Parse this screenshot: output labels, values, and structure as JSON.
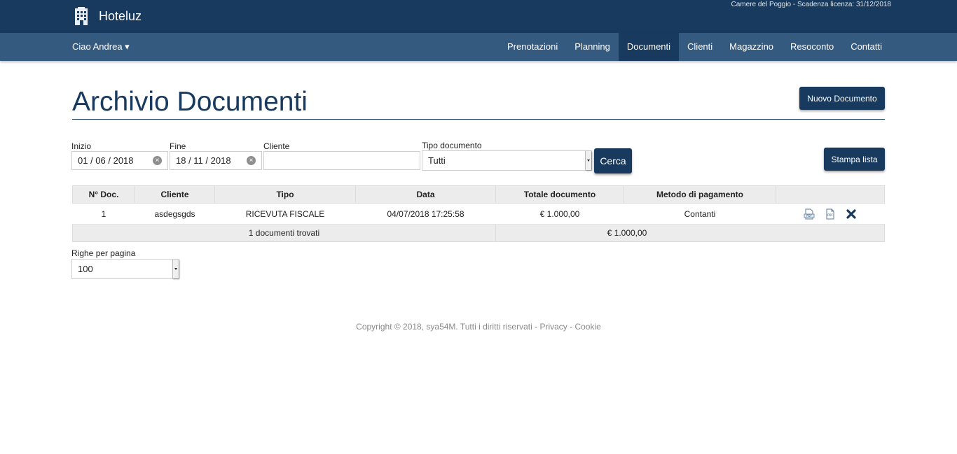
{
  "app": {
    "name": "Hoteluz",
    "license_text": "Camere del Poggio - Scadenza licenza: 31/12/2018"
  },
  "nav": {
    "user_menu": "Ciao Andrea ▾",
    "items": [
      {
        "label": "Prenotazioni"
      },
      {
        "label": "Planning"
      },
      {
        "label": "Documenti",
        "active": true
      },
      {
        "label": "Clienti"
      },
      {
        "label": "Magazzino"
      },
      {
        "label": "Resoconto"
      },
      {
        "label": "Contatti"
      }
    ]
  },
  "page": {
    "title": "Archivio Documenti",
    "new_button": "Nuovo Documento",
    "print_button": "Stampa lista"
  },
  "filters": {
    "start": {
      "label": "Inizio",
      "value": "01 / 06 / 2018"
    },
    "end": {
      "label": "Fine",
      "value": "18 / 11 / 2018"
    },
    "client": {
      "label": "Cliente",
      "value": ""
    },
    "doc_type": {
      "label": "Tipo documento",
      "value": "Tutti"
    },
    "search_button": "Cerca"
  },
  "table": {
    "headers": [
      "N° Doc.",
      "Cliente",
      "Tipo",
      "Data",
      "Totale documento",
      "Metodo di pagamento",
      ""
    ],
    "rows": [
      {
        "num": "1",
        "client": "asdegsgds",
        "type": "RICEVUTA FISCALE",
        "date": "04/07/2018 17:25:58",
        "total": "€ 1.000,00",
        "payment": "Contanti"
      }
    ],
    "footer": {
      "count_text": "1 documenti trovati",
      "total": "€ 1.000,00"
    }
  },
  "pagination": {
    "label": "Righe per pagina",
    "value": "100"
  },
  "footer": {
    "copyright": "Copyright © 2018, sya54M. Tutti i diritti riservati",
    "sep": " - ",
    "privacy": "Privacy",
    "cookie": "Cookie"
  },
  "colors": {
    "primary": "#173a5e",
    "navbar": "#355a80"
  }
}
